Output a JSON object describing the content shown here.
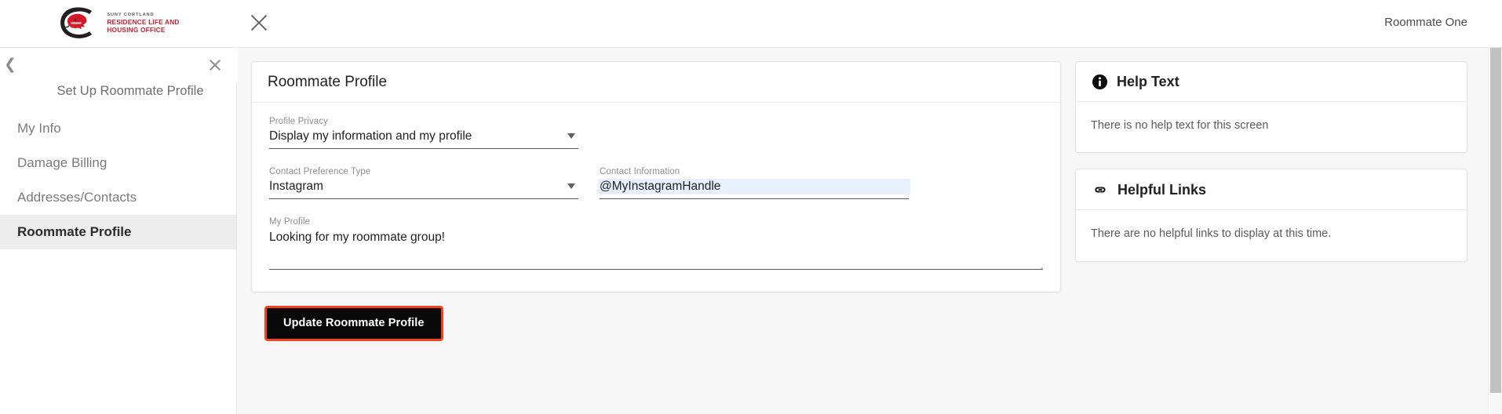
{
  "brand": {
    "logo_sub": "SUNY Cortland",
    "logo_line1": "Residence Life and",
    "logo_line2": "Housing Office",
    "logo_icon": "red-dragon-logo",
    "accent_red": "#d7182a"
  },
  "topbar": {
    "close_icon": "close-icon",
    "user_name": "Roommate One"
  },
  "sidebar": {
    "collapse_icon": "chevron-left-icon",
    "close_icon": "close-x-icon",
    "title": "Set Up Roommate Profile",
    "items": [
      {
        "label": "My Info",
        "active": false
      },
      {
        "label": "Damage Billing",
        "active": false
      },
      {
        "label": "Addresses/Contacts",
        "active": false
      },
      {
        "label": "Roommate Profile",
        "active": true
      }
    ]
  },
  "profile_card": {
    "title": "Roommate Profile",
    "fields": {
      "privacy": {
        "label": "Profile Privacy",
        "value": "Display my information and my profile",
        "control": "select",
        "caret_icon": "chevron-down-icon"
      },
      "contact_type": {
        "label": "Contact Preference Type",
        "value": "Instagram",
        "control": "select",
        "caret_icon": "chevron-down-icon"
      },
      "contact_info": {
        "label": "Contact Information",
        "value": "@MyInstagramHandle",
        "control": "text",
        "highlight_color": "#e8f0fe"
      },
      "my_profile": {
        "label": "My Profile",
        "value": "Looking for my roommate group!",
        "control": "textarea",
        "resize_icon": "resize-grip-icon"
      }
    }
  },
  "actions": {
    "update_label": "Update Roommate Profile",
    "update_border_color": "#f4411e",
    "update_bg_color": "#0a0a0a"
  },
  "help_panel": {
    "icon": "info-circle-icon",
    "title": "Help Text",
    "body": "There is no help text for this screen"
  },
  "links_panel": {
    "icon": "link-chain-icon",
    "title": "Helpful Links",
    "body": "There are no helpful links to display at this time."
  },
  "scrollbar": {
    "name": "vertical-scrollbar"
  }
}
